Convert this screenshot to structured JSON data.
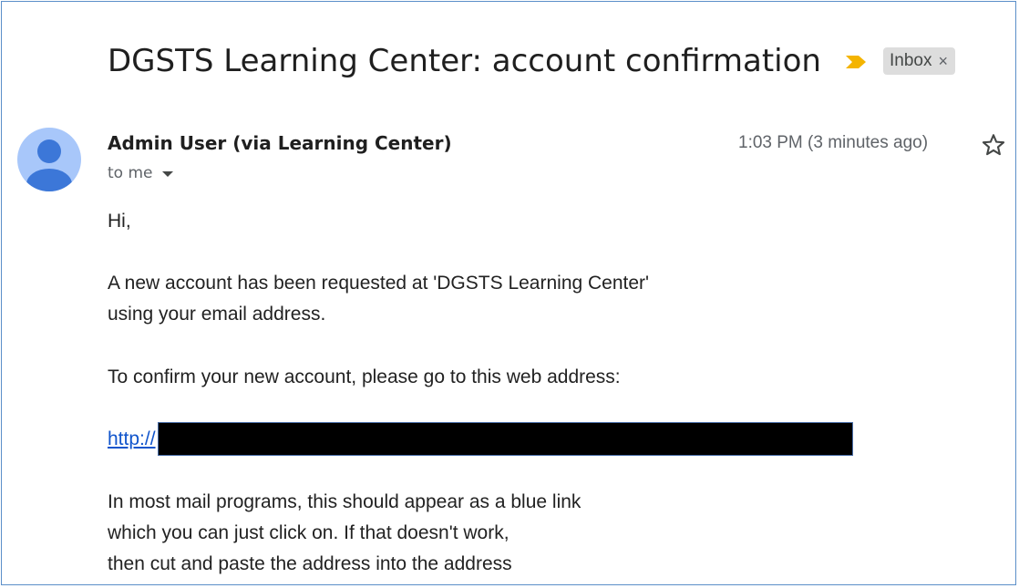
{
  "email": {
    "subject": "DGSTS Learning Center: account confirmation",
    "label": "Inbox",
    "label_remove": "×",
    "sender": "Admin User (via Learning Center)",
    "recipient": "to me",
    "timestamp": "1:03 PM (3 minutes ago)",
    "body": {
      "greeting": "Hi,",
      "para1_line1": "A new account has been requested at 'DGSTS Learning Center'",
      "para1_line2": "using your email address.",
      "para2": "To confirm your new account, please go to this web address:",
      "link_prefix": "http://",
      "para3_line1": "In most mail programs, this should appear as a blue link",
      "para3_line2": "which you can just click on. If that doesn't work,",
      "para3_line3": "then cut and paste the address into the address"
    }
  },
  "icons": {
    "importance": "importance-marker-icon",
    "avatar": "person-icon",
    "star": "star-outline-icon",
    "caret": "caret-down-icon"
  },
  "colors": {
    "importance": "#f4b400",
    "avatar_bg": "#a8c7fa",
    "avatar_fg": "#3c77d8",
    "link": "#1155cc",
    "chip_bg": "#dddddd",
    "frame_border": "#5b8fc9"
  }
}
